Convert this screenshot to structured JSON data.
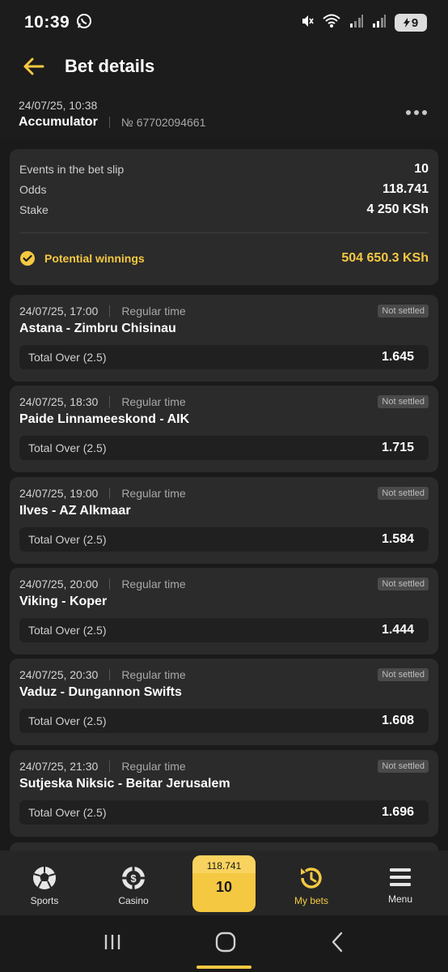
{
  "status_bar": {
    "time": "10:39",
    "battery": "9"
  },
  "header": {
    "title": "Bet details"
  },
  "bet": {
    "datetime": "24/07/25, 10:38",
    "type": "Accumulator",
    "number": "№ 67702094661"
  },
  "summary": {
    "events_label": "Events in the bet slip",
    "events_value": "10",
    "odds_label": "Odds",
    "odds_value": "118.741",
    "stake_label": "Stake",
    "stake_value": "4 250 KSh",
    "winnings_label": "Potential winnings",
    "winnings_value": "504 650.3 KSh"
  },
  "events": [
    {
      "datetime": "24/07/25, 17:00",
      "time_type": "Regular time",
      "status": "Not settled",
      "match": "Astana - Zimbru Chisinau",
      "market": "Total Over (2.5)",
      "odds": "1.645"
    },
    {
      "datetime": "24/07/25, 18:30",
      "time_type": "Regular time",
      "status": "Not settled",
      "match": "Paide Linnameeskond - AIK",
      "market": "Total Over (2.5)",
      "odds": "1.715"
    },
    {
      "datetime": "24/07/25, 19:00",
      "time_type": "Regular time",
      "status": "Not settled",
      "match": "Ilves - AZ Alkmaar",
      "market": "Total Over (2.5)",
      "odds": "1.584"
    },
    {
      "datetime": "24/07/25, 20:00",
      "time_type": "Regular time",
      "status": "Not settled",
      "match": "Viking - Koper",
      "market": "Total Over (2.5)",
      "odds": "1.444"
    },
    {
      "datetime": "24/07/25, 20:30",
      "time_type": "Regular time",
      "status": "Not settled",
      "match": "Vaduz - Dungannon Swifts",
      "market": "Total Over (2.5)",
      "odds": "1.608"
    },
    {
      "datetime": "24/07/25, 21:30",
      "time_type": "Regular time",
      "status": "Not settled",
      "match": "Sutjeska Niksic - Beitar Jerusalem",
      "market": "Total Over (2.5)",
      "odds": "1.696"
    }
  ],
  "nav": {
    "sports": "Sports",
    "casino": "Casino",
    "slip_odds": "118.741",
    "slip_count": "10",
    "my_bets": "My bets",
    "menu": "Menu"
  },
  "colors": {
    "accent": "#f5c842",
    "background": "#1a1a1a",
    "card": "#2b2b2b"
  },
  "icons": [
    "whatsapp-icon",
    "mute-icon",
    "wifi-icon",
    "signal-icon",
    "battery-icon",
    "back-arrow-icon",
    "more-icon",
    "check-circle-icon",
    "soccer-ball-icon",
    "casino-chip-icon",
    "history-icon",
    "menu-icon",
    "recents-icon",
    "home-icon",
    "back-icon"
  ]
}
